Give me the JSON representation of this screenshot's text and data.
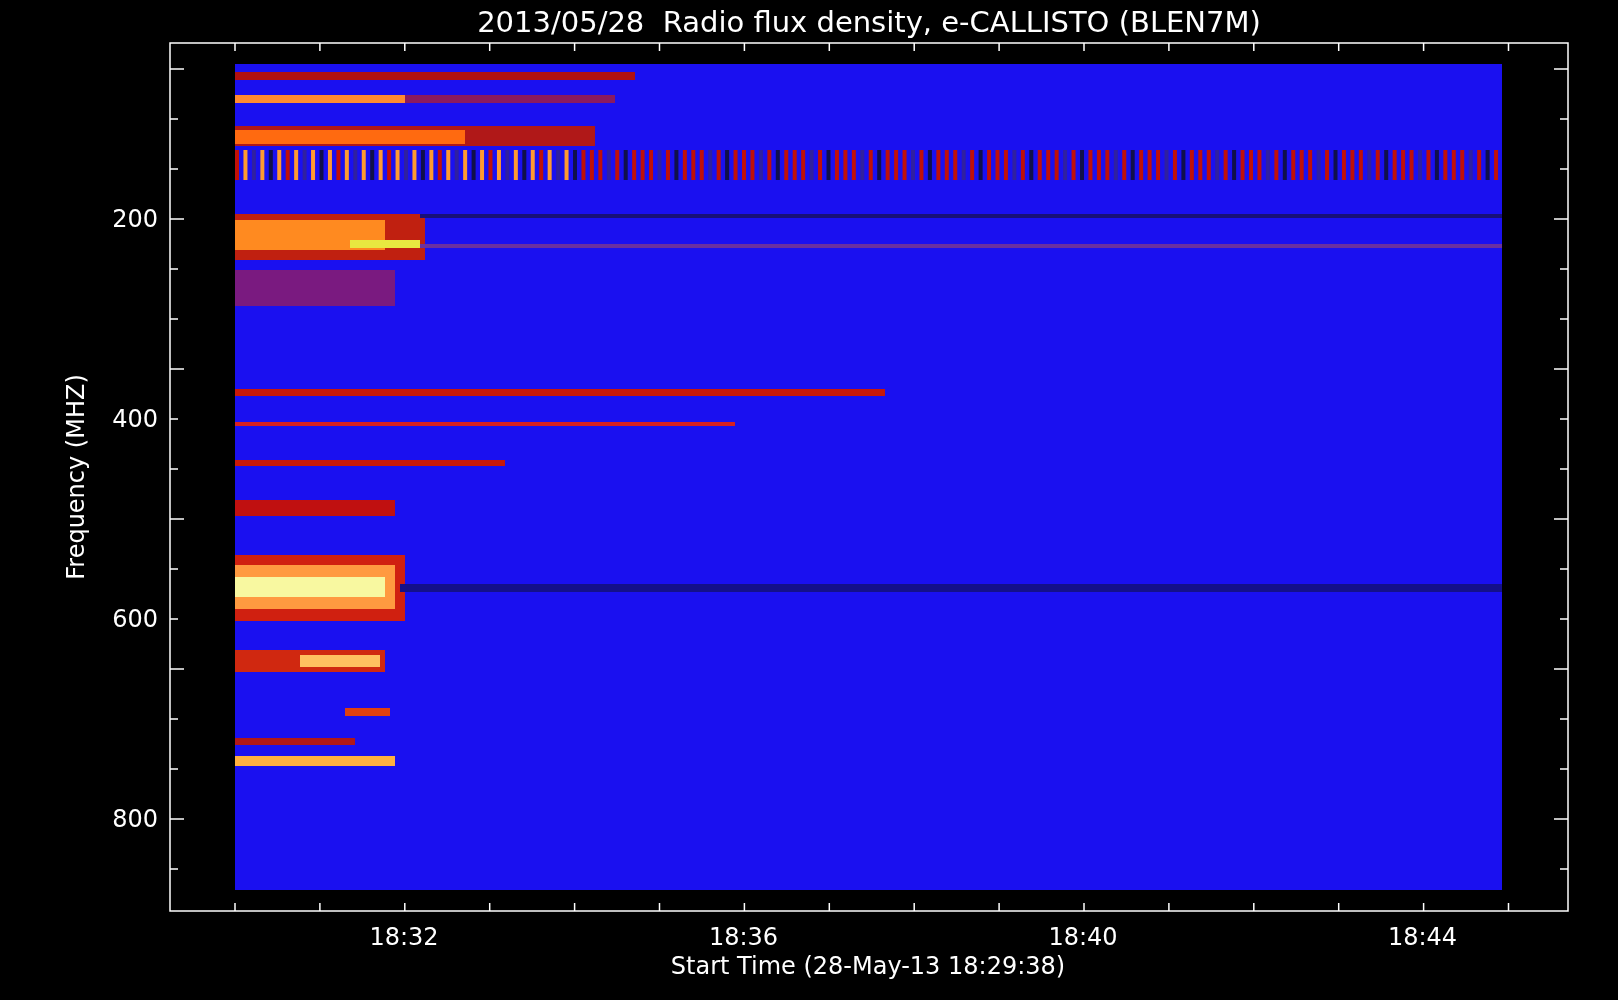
{
  "title": "2013/05/28  Radio flux density, e-CALLISTO (BLEN7M)",
  "y_axis": {
    "label": "Frequency (MHZ)",
    "tick_labels": [
      "200",
      "400",
      "600",
      "800"
    ]
  },
  "x_axis": {
    "label": "Start Time (28-May-13 18:29:38)",
    "tick_labels": [
      "18:32",
      "18:36",
      "18:40",
      "18:44"
    ]
  }
}
